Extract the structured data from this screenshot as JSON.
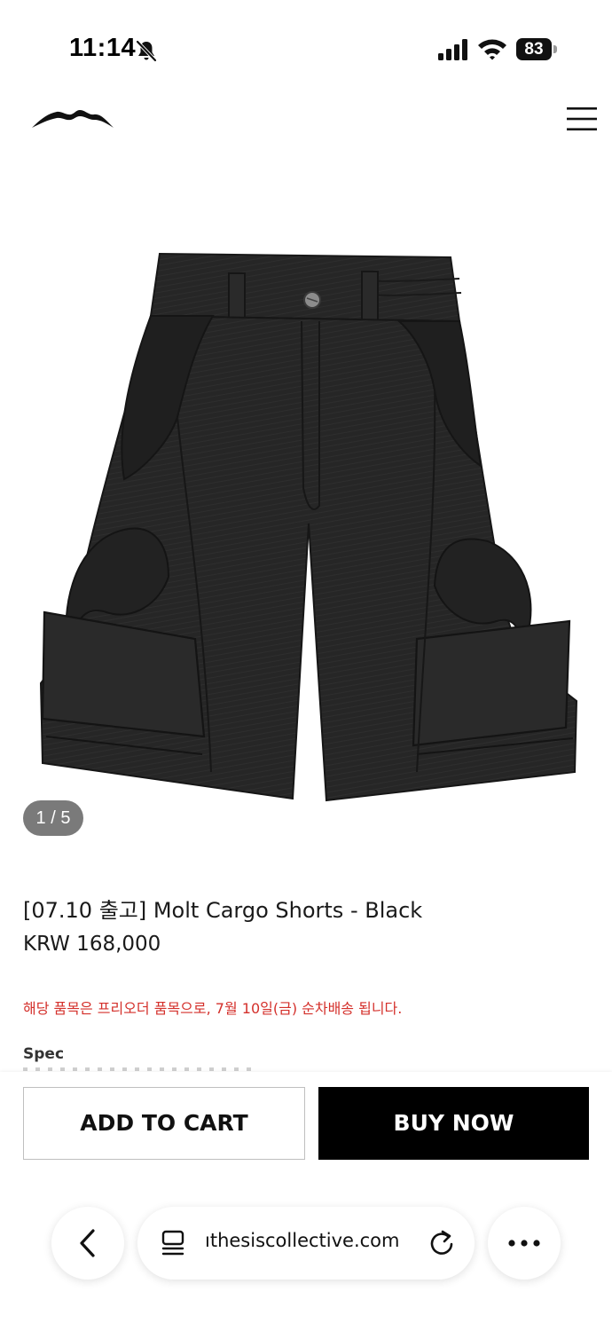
{
  "status_bar": {
    "time": "11:14",
    "battery": "83",
    "icons": [
      "bell-slash-icon",
      "cellular-signal-icon",
      "wifi-icon",
      "battery-icon"
    ]
  },
  "header": {
    "logo": "brand-logo-icon",
    "menu": "hamburger-menu-icon"
  },
  "gallery": {
    "counter": "1 / 5"
  },
  "product": {
    "title": "[07.10 출고] Molt Cargo Shorts - Black",
    "price": "KRW 168,000",
    "notice": "해당 품목은 프리오더 품목으로, 7월 10일(금) 순차배송 됩니다.",
    "spec_label": "Spec"
  },
  "actions": {
    "add_to_cart": "ADD TO CART",
    "buy_now": "BUY NOW"
  },
  "browser": {
    "url": "ıthesiscollective.com",
    "icons": [
      "back-chevron-icon",
      "page-menu-icon",
      "reload-icon",
      "more-dots-icon"
    ]
  },
  "colors": {
    "notice_red": "#d4302b",
    "buy_now_bg": "#000000",
    "counter_bg": "#7a7a7a"
  }
}
